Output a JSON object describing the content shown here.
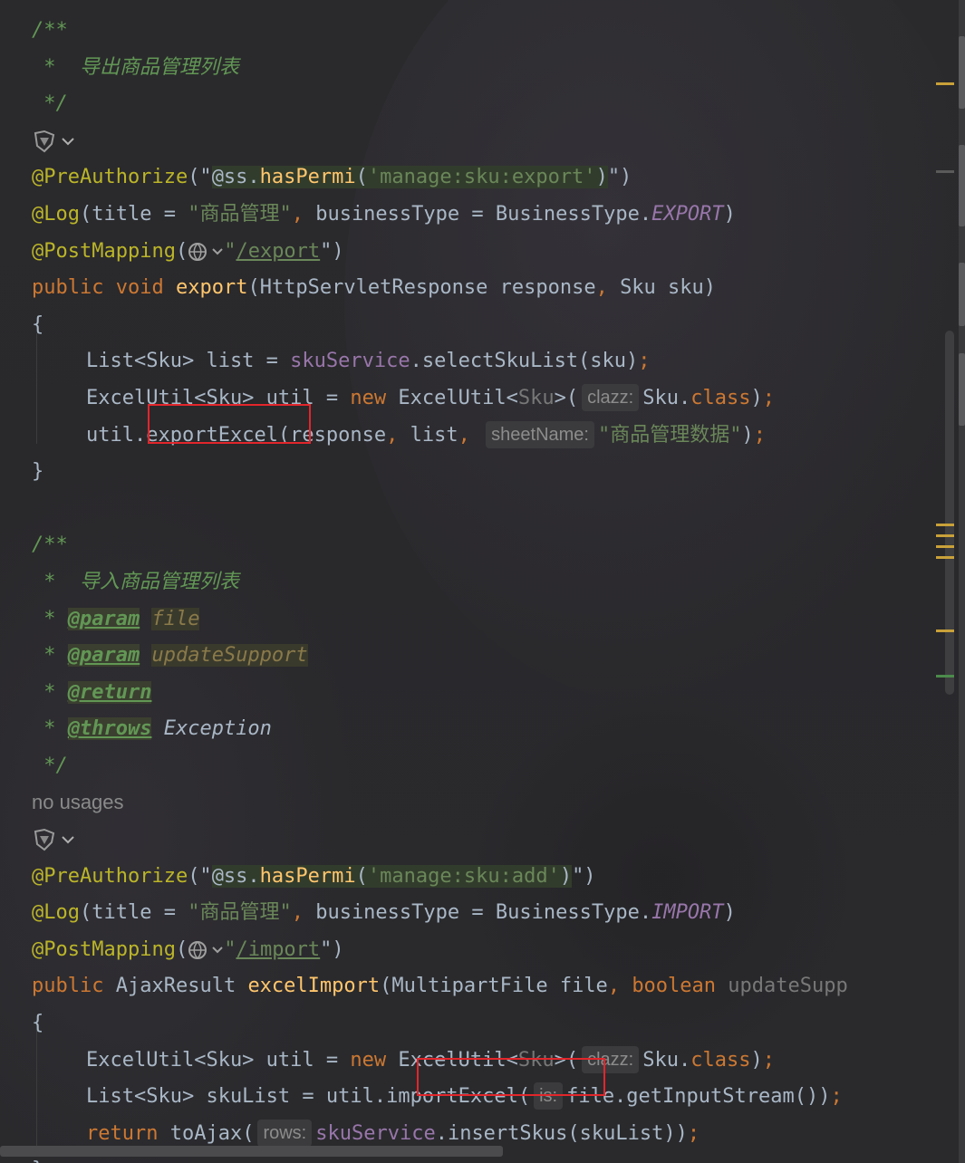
{
  "editor": {
    "language": "java",
    "theme_colors": {
      "background": "#2b2b2b",
      "comment": "#629755",
      "annotation": "#bbb529",
      "string": "#6a8759",
      "keyword": "#cc7832",
      "method": "#ffc66d",
      "field": "#9876aa",
      "text": "#a9b7c6",
      "highlight_box": "#e2262b"
    }
  },
  "export_method": {
    "doc_open": "/**",
    "doc_text": " *  导出商品管理列表",
    "doc_close": " */",
    "ann_preauth_name": "@PreAuthorize",
    "ann_preauth_q1": "(\"",
    "ann_preauth_expr": "@ss.",
    "ann_preauth_call": "hasPermi",
    "ann_preauth_paren": "(",
    "ann_preauth_perm": "'manage:sku:export'",
    "ann_preauth_close": ")",
    "ann_preauth_end": "\")",
    "ann_log_name": "@Log",
    "ann_log_args_1": "(title = ",
    "ann_log_title": "\"商品管理\"",
    "ann_log_comma": ", ",
    "ann_log_args_2": "businessType = BusinessType.",
    "ann_log_type": "EXPORT",
    "ann_log_end": ")",
    "ann_post_name": "@PostMapping",
    "ann_post_open": "(",
    "ann_post_q": "\"",
    "ann_post_path": "/export",
    "ann_post_end": "\")",
    "sig_kw1": "public",
    "sig_kw2": "void",
    "sig_name": "export",
    "sig_params_1": "(HttpServletResponse response",
    "sig_comma": ", ",
    "sig_params_2": "Sku sku)",
    "brace_open": "{",
    "l1_type": "List<Sku> list = ",
    "l1_field": "skuService",
    "l1_call": ".selectSkuList(sku)",
    "l1_semi": ";",
    "l2_type": "ExcelUtil<Sku> util = ",
    "l2_new": "new",
    "l2_ctor": " ExcelUtil",
    "l2_lt": "<",
    "l2_gen": "Sku",
    "l2_gt": ">(",
    "l2_hint": "clazz:",
    "l2_arg": "Sku.",
    "l2_cls": "class",
    "l2_end": ")",
    "l2_semi": ";",
    "l3_obj": "util.",
    "l3_call": "exportExcel",
    "l3_args_1": "(response",
    "l3_c1": ", ",
    "l3_args_2": "list",
    "l3_c2": ", ",
    "l3_hint": "sheetName:",
    "l3_str": "\"商品管理数据\"",
    "l3_end": ")",
    "l3_semi": ";",
    "brace_close": "}"
  },
  "import_method": {
    "doc_open": "/**",
    "doc_text": " *  导入商品管理列表",
    "param_star": " * ",
    "param_tag": "@param",
    "param1_name": "file",
    "param2_name": "updateSupport",
    "return_tag": "@return",
    "throws_tag": "@throws",
    "throws_name": "Exception",
    "doc_close": " */",
    "usages": "no usages",
    "ann_preauth_name": "@PreAuthorize",
    "ann_preauth_q1": "(\"",
    "ann_preauth_expr": "@ss.",
    "ann_preauth_call": "hasPermi",
    "ann_preauth_paren": "(",
    "ann_preauth_perm": "'manage:sku:add'",
    "ann_preauth_close": ")",
    "ann_preauth_end": "\")",
    "ann_log_name": "@Log",
    "ann_log_args_1": "(title = ",
    "ann_log_title": "\"商品管理\"",
    "ann_log_comma": ", ",
    "ann_log_args_2": "businessType = BusinessType.",
    "ann_log_type": "IMPORT",
    "ann_log_end": ")",
    "ann_post_name": "@PostMapping",
    "ann_post_open": "(",
    "ann_post_q": "\"",
    "ann_post_path": "/import",
    "ann_post_end": "\")",
    "sig_kw1": "public",
    "sig_ret": "AjaxResult",
    "sig_name": "excelImport",
    "sig_params_1": "(MultipartFile file",
    "sig_comma": ", ",
    "sig_kw_bool": "boolean",
    "sig_params_2": "updateSupp",
    "brace_open": "{",
    "l1_type": "ExcelUtil<Sku> util = ",
    "l1_new": "new",
    "l1_ctor": " ExcelUtil",
    "l1_lt": "<",
    "l1_gen": "Sku",
    "l1_gt": ">(",
    "l1_hint": "clazz:",
    "l1_arg": "Sku.",
    "l1_cls": "class",
    "l1_end": ")",
    "l1_semi": ";",
    "l2_type": "List<Sku> skuList = ",
    "l2_obj": "util",
    "l2_call": ".importExcel(",
    "l2_hint": "is:",
    "l2_arg": "file.getInputStream())",
    "l2_semi": ";",
    "l3_kw": "return",
    "l3_call": " toAjax(",
    "l3_hint": "rows:",
    "l3_field": "skuService",
    "l3_call2": ".insertSkus",
    "l3_args": "(skuList))",
    "l3_semi": ";",
    "brace_close": "}"
  }
}
